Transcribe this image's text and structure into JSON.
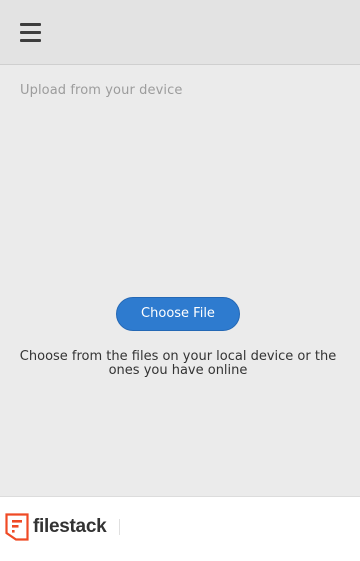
{
  "header": {
    "menu_icon": "hamburger-menu-icon"
  },
  "main": {
    "section_label": "Upload from your device",
    "choose_button_label": "Choose File",
    "description": "Choose from the files on your local device or the ones you have online"
  },
  "footer": {
    "brand_name": "filestack",
    "brand_icon": "filestack-logo-icon",
    "brand_color": "#ef4a25"
  },
  "colors": {
    "accent": "#2e7bcf",
    "background": "#ebebeb",
    "header_background": "#e3e3e3"
  }
}
